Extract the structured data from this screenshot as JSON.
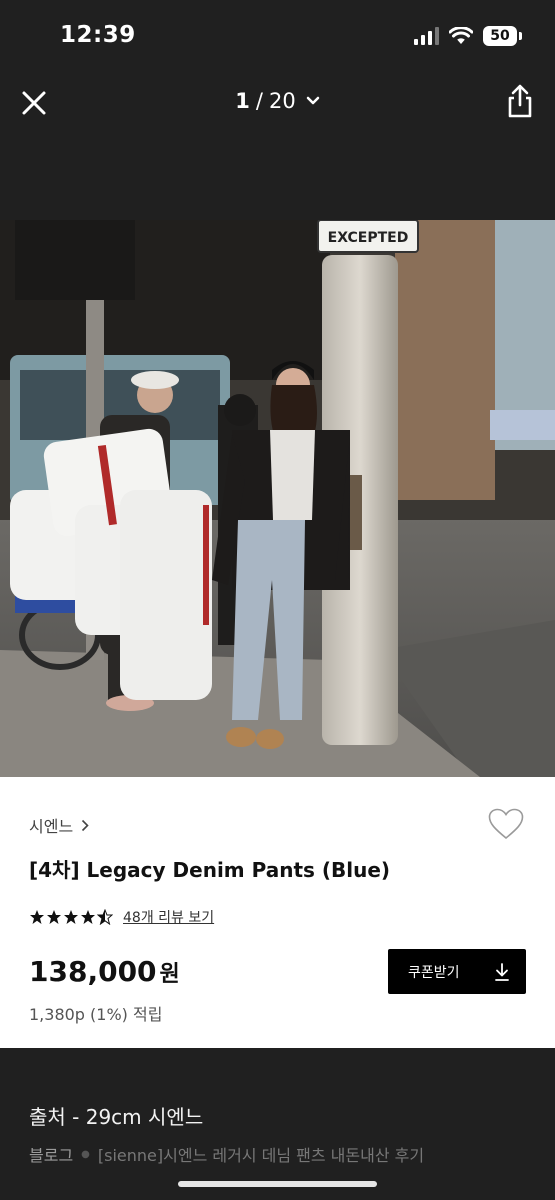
{
  "status_bar": {
    "time": "12:39",
    "battery": "50"
  },
  "viewer": {
    "current": "1",
    "separator": "/",
    "total": "20"
  },
  "photo": {
    "sign_text": "EXCEPTED"
  },
  "product": {
    "brand": "시엔느",
    "title": "[4차] Legacy Denim Pants (Blue)",
    "rating": 4.5,
    "reviews_link": "48개 리뷰 보기",
    "price": "138,000",
    "currency": "원",
    "points": "1,380p (1%) 적립",
    "coupon_label": "쿠폰받기"
  },
  "source": {
    "title": "출처 - 29cm 시엔느",
    "blog_label": "블로그",
    "post_title": "[sienne]시엔느 레거시 데님 팬츠 내돈내산 후기"
  }
}
